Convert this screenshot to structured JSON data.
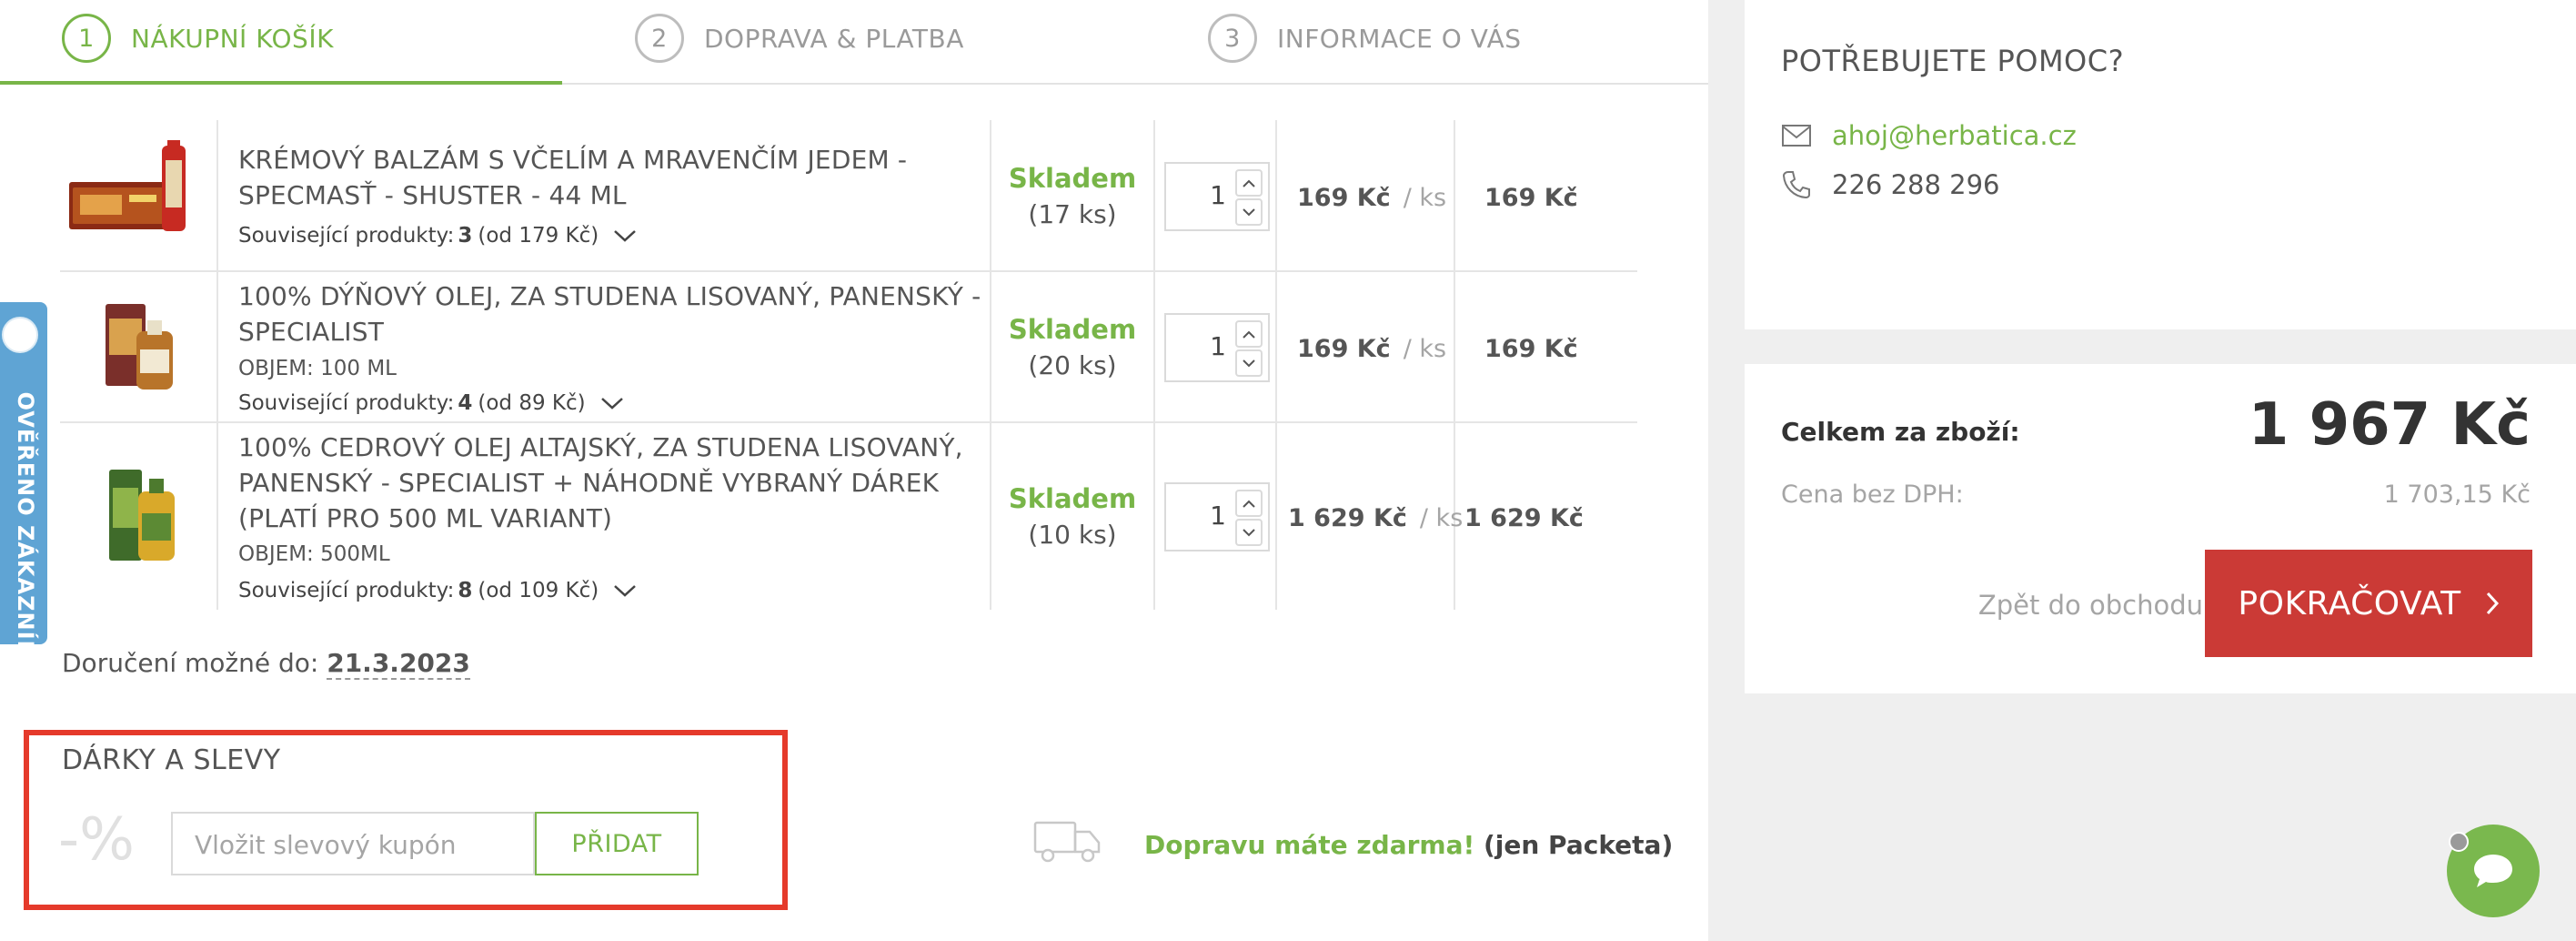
{
  "steps": [
    {
      "num": "1",
      "label": "NÁKUPNÍ KOŠÍK"
    },
    {
      "num": "2",
      "label": "DOPRAVA & PLATBA"
    },
    {
      "num": "3",
      "label": "INFORMACE O VÁS"
    }
  ],
  "items": [
    {
      "name": "KRÉMOVÝ BALZÁM S VČELÍM A MRAVENČÍM JEDEM - SPECMASŤ - SHUSTER - 44 ML",
      "variant": "",
      "related_label": "Související produkty:",
      "related_count": "3",
      "related_from": "(od 179 Kč)",
      "stock_label": "Skladem",
      "stock_count": "(17 ks)",
      "qty": "1",
      "unit_price": "169 Kč",
      "unit": "/ ks",
      "total": "169 Kč"
    },
    {
      "name": "100% DÝŇOVÝ OLEJ, ZA STUDENA LISOVANÝ, PANENSKÝ - SPECIALIST",
      "variant": "OBJEM: 100 ML",
      "related_label": "Související produkty:",
      "related_count": "4",
      "related_from": "(od 89 Kč)",
      "stock_label": "Skladem",
      "stock_count": "(20 ks)",
      "qty": "1",
      "unit_price": "169 Kč",
      "unit": "/ ks",
      "total": "169 Kč"
    },
    {
      "name": "100% CEDROVÝ OLEJ ALTAJSKÝ, ZA STUDENA LISOVANÝ, PANENSKÝ - SPECIALIST + NÁHODNĚ VYBRANÝ DÁREK (PLATÍ PRO 500 ML VARIANT)",
      "variant": "OBJEM: 500ML",
      "related_label": "Související produkty:",
      "related_count": "8",
      "related_from": "(od 109 Kč)",
      "stock_label": "Skladem",
      "stock_count": "(10 ks)",
      "qty": "1",
      "unit_price": "1 629 Kč",
      "unit": "/ ks",
      "total": "1 629 Kč"
    }
  ],
  "delivery": {
    "label": "Doručení možné do:",
    "date": "21.3.2023"
  },
  "gifts": {
    "title": "DÁRKY A SLEVY",
    "percent_symbol": "-%",
    "coupon_placeholder": "Vložit slevový kupón",
    "add_label": "PŘIDAT"
  },
  "shipping": {
    "free_text": "Dopravu máte zdarma!",
    "carrier": "(jen Packeta)"
  },
  "help": {
    "title": "POTŘEBUJETE POMOC?",
    "email": "ahoj@herbatica.cz",
    "phone": "226 288 296"
  },
  "summary": {
    "total_label": "Celkem za zboží:",
    "total_value": "1 967 Kč",
    "vat_label": "Cena bez DPH:",
    "vat_value": "1 703,15 Kč",
    "back_label": "Zpět do obchodu",
    "continue_label": "POKRAČOVAT"
  },
  "side_tab": {
    "label": "OVĚŘENO ZÁKAZNÍKY"
  },
  "colors": {
    "accent": "#78b548",
    "cta": "#cb3a36",
    "highlight": "#e53a2b",
    "side_tab": "#5fa4d4"
  }
}
